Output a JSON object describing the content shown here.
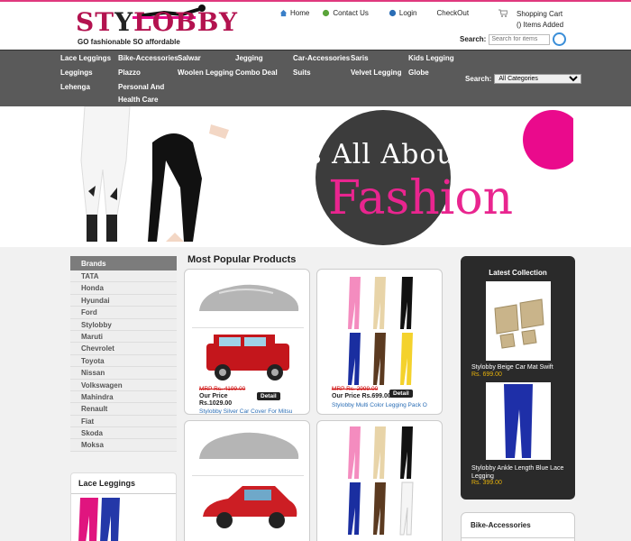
{
  "brand": {
    "name_a": "ST",
    "name_b": "Y",
    "name_c": "LOBBY",
    "tagline": "GO fashionable SO affordable"
  },
  "toplinks": [
    {
      "label": "Home",
      "icon": "home-icon"
    },
    {
      "label": "Contact Us",
      "icon": "contact-icon"
    },
    {
      "label": "Login",
      "icon": "login-icon"
    },
    {
      "label": "CheckOut",
      "icon": "checkout-icon"
    }
  ],
  "cart": {
    "title": "Shopping Cart",
    "items": "() Items Added"
  },
  "header_search": {
    "label": "Search:",
    "placeholder": "Search for items"
  },
  "nav": {
    "items": [
      "Lace Leggings",
      "Bike-Accessories",
      "Salwar",
      "Jegging",
      "Car-Accessories",
      "Saris",
      "Kids Legging",
      "Leggings",
      "Plazzo",
      "Woolen Legging",
      "Combo Deal",
      "Suits",
      "Velvet Legging",
      "Globe",
      "Lehenga",
      "Personal And",
      "Health Care"
    ],
    "search_label": "Search:",
    "category": "All Categories"
  },
  "banner": {
    "line1": "It's All About",
    "line2": "Fashion"
  },
  "brands": {
    "title": "Brands",
    "items": [
      "TATA",
      "Honda",
      "Hyundai",
      "Ford",
      "Stylobby",
      "Maruti",
      "Chevrolet",
      "Toyota",
      "Nissan",
      "Volkswagen",
      "Mahindra",
      "Renault",
      "Fiat",
      "Skoda",
      "Moksa"
    ]
  },
  "side_box": {
    "title": "Lace Leggings"
  },
  "popular": {
    "title": "Most Popular Products",
    "products": [
      {
        "mrp_label": "MRP",
        "mrp": "Rs. 4199.00",
        "our_price": "Our Price",
        "price": "Rs.1029.00",
        "detail": "Detail",
        "name": "Stylobby Silver Car Cover For Mitsu"
      },
      {
        "mrp_label": "MRP",
        "mrp": "Rs. 2999.00",
        "our_price": "Our Price",
        "price": "Rs.699.00",
        "detail": "Detail",
        "name": "Stylobby Multi Color Legging Pack O"
      }
    ]
  },
  "latest": {
    "title": "Latest Collection",
    "items": [
      {
        "name": "Stylobby Beige Car Mat Swift",
        "price": "Rs. 699.00"
      },
      {
        "name": "Stylobby Ankle Length Blue Lace Legging",
        "price": "Rs. 399.00"
      }
    ]
  },
  "bike_box": {
    "title": "Bike-Accessories"
  },
  "colors": {
    "accent": "#e0387e",
    "nav_bg": "#5a5a5a",
    "link": "#2a6db5",
    "price_gold": "#e6b10c"
  }
}
